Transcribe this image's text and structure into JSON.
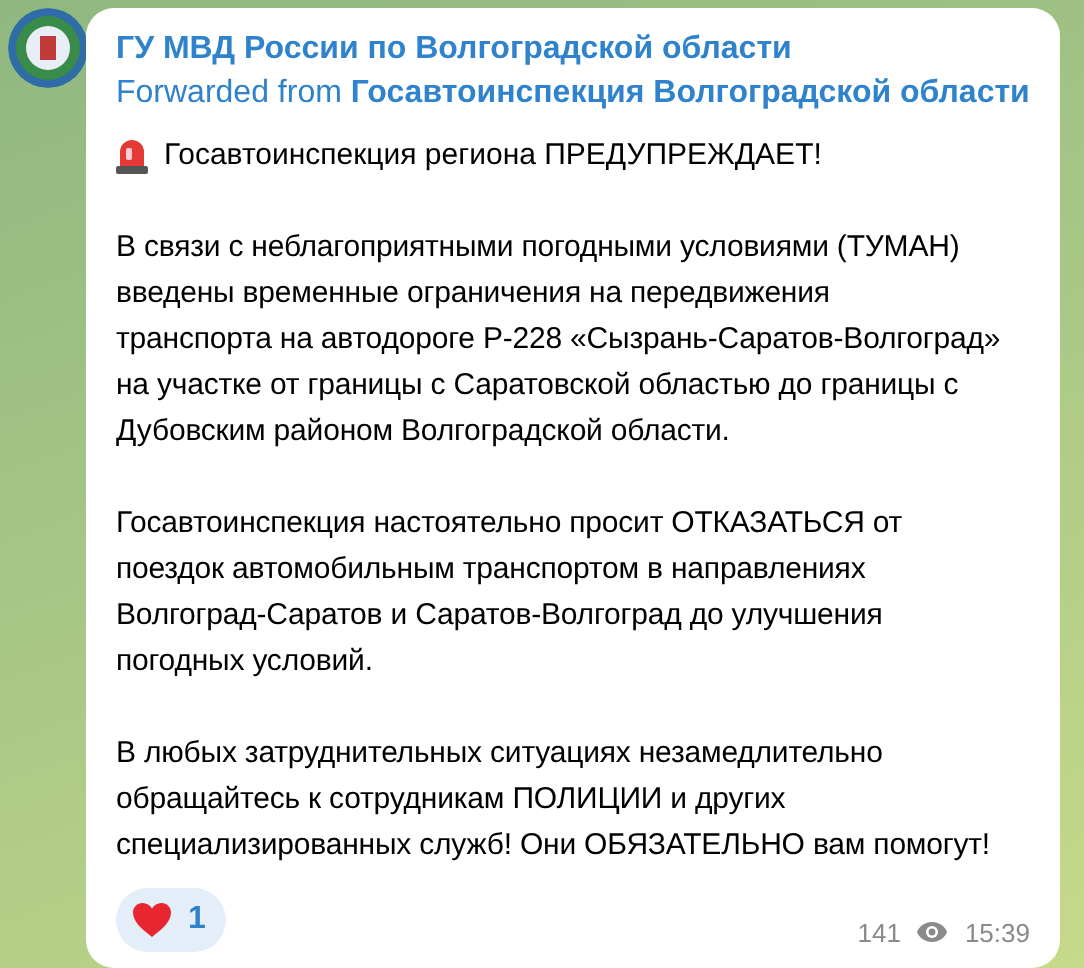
{
  "message": {
    "sender": "ГУ МВД России по Волгоградской области",
    "forwarded_label": "Forwarded from",
    "forwarded_source": "Госавтоинспекция Волгоградской области",
    "headline": "Госавтоинспекция региона ПРЕДУПРЕЖДАЕТ!",
    "paragraphs": [
      "В связи с неблагоприятными погодными условиями (ТУМАН)\nвведены временные ограничения на передвижения\nтранспорта на автодороге Р-228 «Сызрань-Саратов-Волгоград»\nна участке от границы с Саратовской областью до границы с\nДубовским районом Волгоградской области.",
      "Госавтоинспекция настоятельно просит ОТКАЗАТЬСЯ от\nпоездок автомобильным транспортом в направлениях\nВолгоград-Саратов и Саратов-Волгоград до улучшения\nпогодных условий.",
      "В любых затруднительных ситуациях незамедлительно\nобращайтесь к сотрудникам ПОЛИЦИИ и других\nспециализированных служб! Они ОБЯЗАТЕЛЬНО вам помогут!"
    ],
    "reactions": [
      {
        "count": "1",
        "selected": false
      }
    ],
    "views": "141",
    "time": "15:39"
  }
}
